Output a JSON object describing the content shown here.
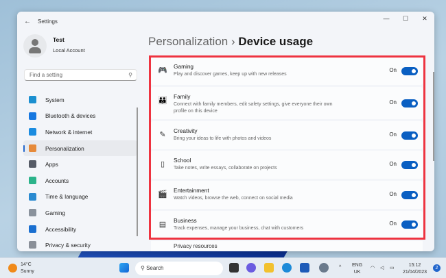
{
  "window": {
    "title": "Settings",
    "back": "←",
    "minimize": "—",
    "maximize": "☐",
    "close": "✕"
  },
  "user": {
    "name": "Test",
    "type": "Local Account"
  },
  "search": {
    "placeholder": "Find a setting"
  },
  "nav": [
    {
      "label": "System",
      "icon": "system-icon",
      "color": "#1a8fd0"
    },
    {
      "label": "Bluetooth & devices",
      "icon": "bluetooth-icon",
      "color": "#1677e0"
    },
    {
      "label": "Network & internet",
      "icon": "wifi-icon",
      "color": "#1b8ce0"
    },
    {
      "label": "Personalization",
      "icon": "brush-icon",
      "color": "#e68a3a",
      "selected": true
    },
    {
      "label": "Apps",
      "icon": "apps-icon",
      "color": "#555b66"
    },
    {
      "label": "Accounts",
      "icon": "accounts-icon",
      "color": "#2bb38a"
    },
    {
      "label": "Time & language",
      "icon": "globe-clock-icon",
      "color": "#2a8ad0"
    },
    {
      "label": "Gaming",
      "icon": "gamepad-icon",
      "color": "#8a929c"
    },
    {
      "label": "Accessibility",
      "icon": "accessibility-icon",
      "color": "#1a6fd0"
    },
    {
      "label": "Privacy & security",
      "icon": "shield-icon",
      "color": "#8a8f98"
    }
  ],
  "breadcrumb": {
    "parent": "Personalization",
    "sep": "›",
    "current": "Device usage"
  },
  "accent": "#0a5fc2",
  "highlight": "#ee3340",
  "items": [
    {
      "title": "Gaming",
      "desc": "Play and discover games, keep up with new releases",
      "state": "On",
      "on": true,
      "icon": "gamepad-icon",
      "glyph": "🎮"
    },
    {
      "title": "Family",
      "desc": "Connect with family members, edit safety settings, give everyone their own profile on this device",
      "state": "On",
      "on": true,
      "icon": "family-icon",
      "glyph": "👪"
    },
    {
      "title": "Creativity",
      "desc": "Bring your ideas to life with photos and videos",
      "state": "On",
      "on": true,
      "icon": "creativity-icon",
      "glyph": "✎"
    },
    {
      "title": "School",
      "desc": "Take notes, write essays, collaborate on projects",
      "state": "On",
      "on": true,
      "icon": "notebook-icon",
      "glyph": "▯"
    },
    {
      "title": "Entertainment",
      "desc": "Watch videos, browse the web, connect on social media",
      "state": "On",
      "on": true,
      "icon": "clapperboard-icon",
      "glyph": "🎬"
    },
    {
      "title": "Business",
      "desc": "Track expenses, manage your business, chat with customers",
      "state": "On",
      "on": true,
      "icon": "document-icon",
      "glyph": "▤"
    }
  ],
  "peek": "Privacy resources",
  "taskbar": {
    "temp": "14°C",
    "weather": "Sunny",
    "search": "Search",
    "lang1": "ENG",
    "lang2": "UK",
    "time": "15:12",
    "date": "21/04/2023",
    "notifications": "2"
  }
}
